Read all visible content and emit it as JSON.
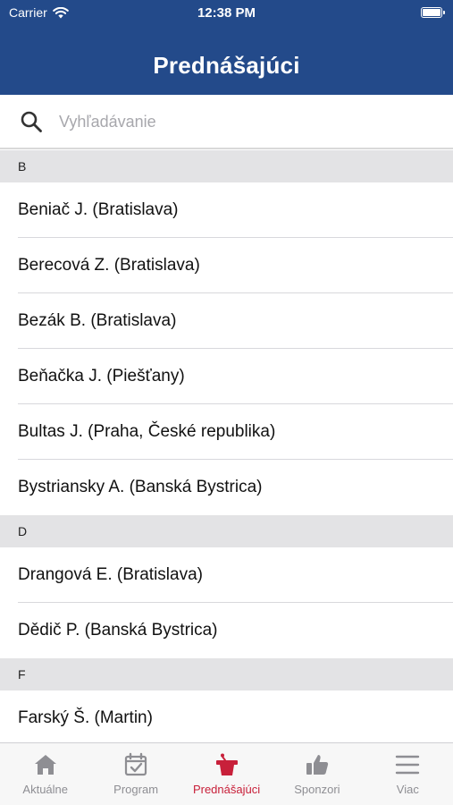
{
  "status_bar": {
    "carrier": "Carrier",
    "time": "12:38 PM"
  },
  "nav": {
    "title": "Prednášajúci"
  },
  "search": {
    "placeholder": "Vyhľadávanie",
    "icon": "search-icon"
  },
  "sections": [
    {
      "letter": "B",
      "items": [
        "Beniač J. (Bratislava)",
        "Berecová Z. (Bratislava)",
        "Bezák B. (Bratislava)",
        "Beňačka J. (Piešťany)",
        "Bultas J. (Praha, České republika)",
        "Bystriansky A. (Banská Bystrica)"
      ]
    },
    {
      "letter": "D",
      "items": [
        "Drangová E. (Bratislava)",
        "Dědič P. (Banská Bystrica)"
      ]
    },
    {
      "letter": "F",
      "items": [
        "Farský Š. (Martin)"
      ]
    }
  ],
  "tabs": [
    {
      "label": "Aktuálne",
      "icon": "home-icon",
      "active": false
    },
    {
      "label": "Program",
      "icon": "calendar-check-icon",
      "active": false
    },
    {
      "label": "Prednášajúci",
      "icon": "podium-icon",
      "active": true
    },
    {
      "label": "Sponzori",
      "icon": "thumbs-up-icon",
      "active": false
    },
    {
      "label": "Viac",
      "icon": "menu-icon",
      "active": false
    }
  ],
  "colors": {
    "header": "#234a8a",
    "active_tab": "#c8203a",
    "inactive_tab": "#8e8e93",
    "section_bg": "#e3e3e5"
  }
}
